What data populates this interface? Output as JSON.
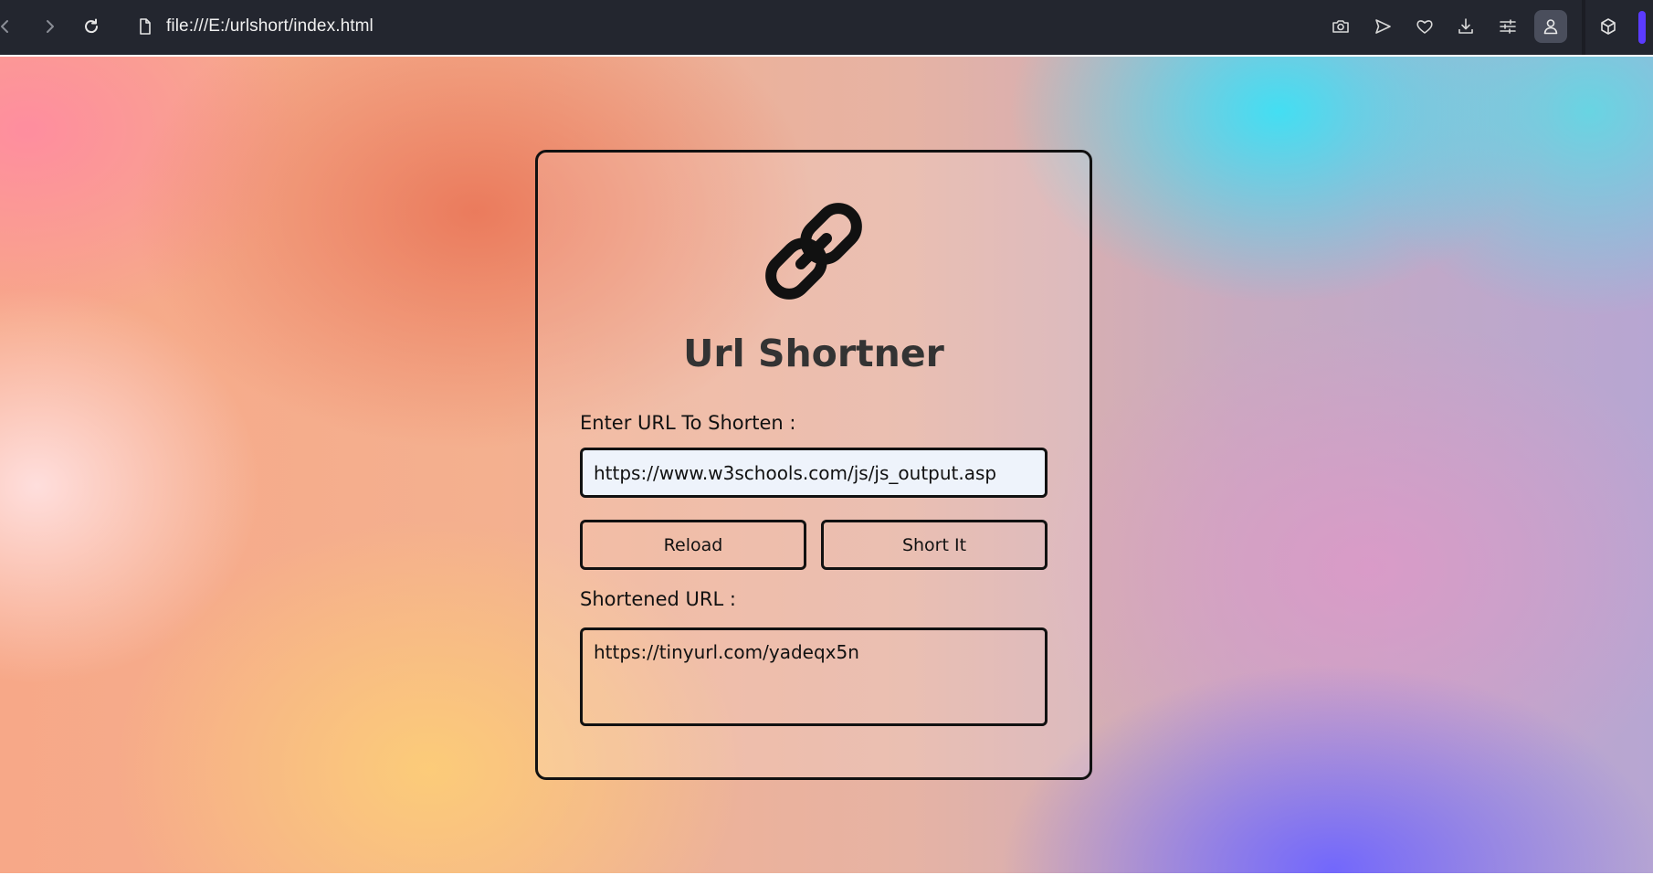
{
  "browser": {
    "url": "file:///E:/urlshort/index.html"
  },
  "icons": {
    "back": "chevron-left-icon",
    "forward": "chevron-right-icon",
    "reload": "reload-icon",
    "page": "file-icon",
    "camera": "camera-icon",
    "send": "send-icon",
    "heart": "heart-icon",
    "download": "download-icon",
    "settings": "sliders-icon",
    "profile": "user-icon",
    "extensions": "cube-icon",
    "logo": "link-icon"
  },
  "app": {
    "title": "Url Shortner",
    "input_label": "Enter URL To Shorten :",
    "input_value": "https://www.w3schools.com/js/js_output.asp",
    "reload_label": "Reload",
    "short_label": "Short It",
    "output_label": "Shortened URL :",
    "output_value": "https://tinyurl.com/yadeqx5n"
  },
  "colors": {
    "chrome_bg": "#23262f",
    "accent": "#5b3bff",
    "border": "#111111",
    "title": "#333333",
    "input_bg": "#eef3fb"
  }
}
